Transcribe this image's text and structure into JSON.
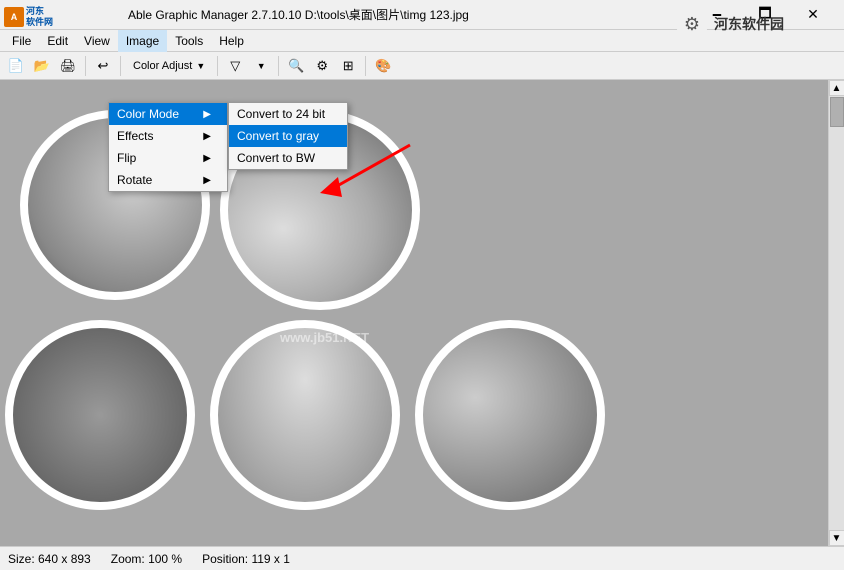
{
  "titlebar": {
    "title": "Able Graphic Manager 2.7.10.10  D:\\tools\\桌面\\图片\\timg 123.jpg",
    "min_label": "🗕",
    "max_label": "🗖",
    "close_label": "✕"
  },
  "menubar": {
    "items": [
      "File",
      "Edit",
      "View",
      "Image",
      "Tools",
      "Help"
    ]
  },
  "toolbar": {
    "color_adjust_label": "Color Adjust"
  },
  "watermark": {
    "text": "河东软件园"
  },
  "menus": {
    "image_menu": {
      "items": [
        {
          "label": "Color Mode",
          "has_sub": true,
          "active": true
        },
        {
          "label": "Effects",
          "has_sub": true,
          "active": false
        },
        {
          "label": "Flip",
          "has_sub": true,
          "active": false
        },
        {
          "label": "Rotate",
          "has_sub": true,
          "active": false
        }
      ]
    },
    "color_mode_menu": {
      "items": [
        {
          "label": "Convert to 24 bit",
          "active": false
        },
        {
          "label": "Convert to gray",
          "active": true
        },
        {
          "label": "Convert to BW",
          "active": false
        }
      ]
    }
  },
  "status": {
    "size": "Size: 640 x 893",
    "zoom": "Zoom: 100 %",
    "position": "Position: 119 x 1"
  }
}
